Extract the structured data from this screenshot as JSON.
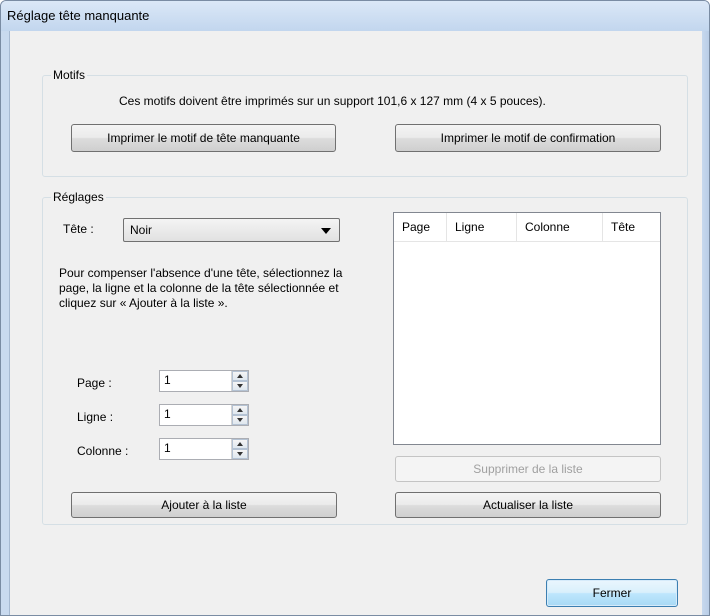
{
  "window": {
    "title": "Réglage tête manquante"
  },
  "motifs": {
    "legend": "Motifs",
    "description": "Ces motifs doivent être imprimés sur un support 101,6 x 127 mm (4 x 5 pouces).",
    "btn_missing_head": "Imprimer le motif de tête manquante",
    "btn_confirmation": "Imprimer le motif de confirmation"
  },
  "reglages": {
    "legend": "Réglages",
    "tete_label": "Tête :",
    "tete_value": "Noir",
    "instructions": "Pour compenser l'absence d'une tête, sélectionnez la page, la ligne et la colonne de la tête sélectionnée et cliquez sur « Ajouter à la liste ».",
    "page_label": "Page :",
    "page_value": "1",
    "ligne_label": "Ligne :",
    "ligne_value": "1",
    "colonne_label": "Colonne :",
    "colonne_value": "1",
    "add_button": "Ajouter à la liste",
    "list_columns": [
      "Page",
      "Ligne",
      "Colonne",
      "Tête"
    ],
    "remove_button": "Supprimer de la liste",
    "refresh_button": "Actualiser la liste"
  },
  "footer": {
    "close_button": "Fermer"
  }
}
